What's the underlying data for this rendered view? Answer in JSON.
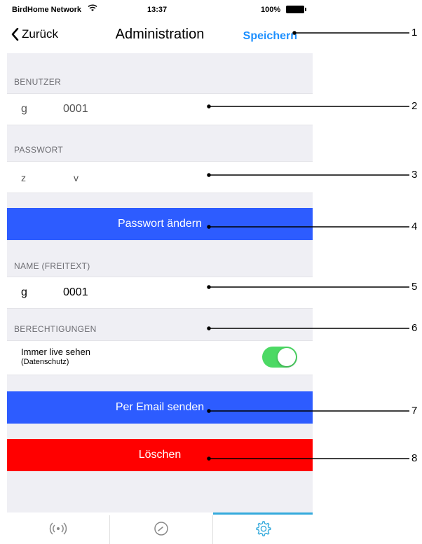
{
  "status_bar": {
    "carrier": "BirdHome Network",
    "time": "13:37",
    "battery": "100%"
  },
  "navbar": {
    "back_label": "Zurück",
    "title": "Administration",
    "save_label": "Speichern"
  },
  "benutzer": {
    "section_label": "BENUTZER",
    "value_prefix": "g",
    "value_number": "0001"
  },
  "passwort": {
    "section_label": "PASSWORT",
    "value_prefix": "z",
    "value_suffix": "v"
  },
  "change_password_button": "Passwort ändern",
  "name": {
    "section_label": "NAME (FREITEXT)",
    "value_prefix": "g",
    "value_number": "0001"
  },
  "permissions": {
    "section_label": "BERECHTIGUNGEN",
    "live_label": "Immer live sehen",
    "live_sublabel": "(Datenschutz)",
    "live_enabled": true
  },
  "email_button": "Per Email senden",
  "delete_button": "Löschen",
  "tabbar": {
    "tabs": [
      "live-icon",
      "clock-icon",
      "settings-icon"
    ],
    "active_index": 2
  },
  "callouts": [
    "1",
    "2",
    "3",
    "4",
    "5",
    "6",
    "7",
    "8"
  ],
  "colors": {
    "accent_blue": "#2d5cff",
    "delete_red": "#ff0000",
    "toggle_green": "#4cd964",
    "link_blue": "#1e90ff"
  }
}
